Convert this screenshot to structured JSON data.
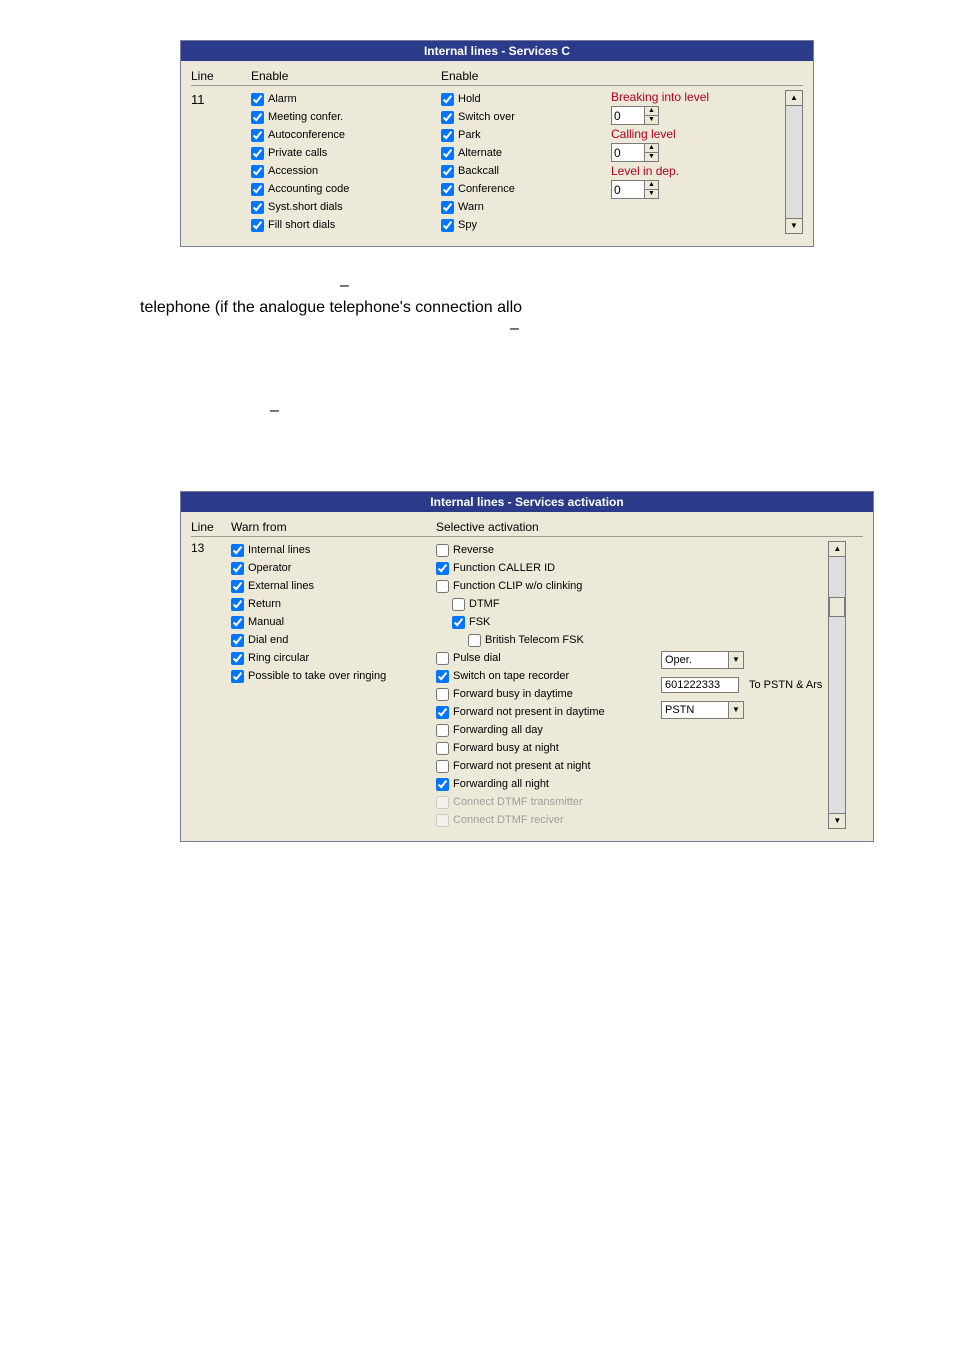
{
  "panel1": {
    "title": "Internal lines - Services C",
    "headers": {
      "line": "Line",
      "enable1": "Enable",
      "enable2": "Enable"
    },
    "line": "11",
    "colA": [
      {
        "label": "Alarm",
        "checked": true
      },
      {
        "label": "Meeting confer.",
        "checked": true
      },
      {
        "label": "Autoconference",
        "checked": true
      },
      {
        "label": "Private calls",
        "checked": true
      },
      {
        "label": "Accession",
        "checked": true
      },
      {
        "label": "Accounting code",
        "checked": true
      },
      {
        "label": "Syst.short dials",
        "checked": true
      },
      {
        "label": "Fill short dials",
        "checked": true
      }
    ],
    "colB": [
      {
        "label": "Hold",
        "checked": true
      },
      {
        "label": "Switch over",
        "checked": true
      },
      {
        "label": "Park",
        "checked": true
      },
      {
        "label": "Alternate",
        "checked": true
      },
      {
        "label": "Backcall",
        "checked": true
      },
      {
        "label": "Conference",
        "checked": true
      },
      {
        "label": "Warn",
        "checked": true
      },
      {
        "label": "Spy",
        "checked": true
      }
    ],
    "spinners": [
      {
        "label": "Breaking into level",
        "value": "0"
      },
      {
        "label": "Calling level",
        "value": "0"
      },
      {
        "label": "Level in dep.",
        "value": "0"
      }
    ]
  },
  "doc_dash1": "–",
  "doc_line2": "telephone (if the analogue telephone's connection allo",
  "doc_dash2": "–",
  "doc_dash3": "–",
  "panel2": {
    "title": "Internal lines - Services activation",
    "headers": {
      "line": "Line",
      "warn": "Warn from",
      "sel": "Selective activation"
    },
    "line": "13",
    "warn": [
      {
        "label": "Internal lines",
        "checked": true
      },
      {
        "label": "Operator",
        "checked": true
      },
      {
        "label": "External lines",
        "checked": true
      },
      {
        "label": "Return",
        "checked": true
      },
      {
        "label": "Manual",
        "checked": true
      },
      {
        "label": "Dial end",
        "checked": true
      },
      {
        "label": "Ring circular",
        "checked": true
      },
      {
        "label": "Possible to take over ringing",
        "checked": true
      }
    ],
    "sel": [
      {
        "label": "Reverse",
        "checked": false,
        "indent": 0
      },
      {
        "label": "Function CALLER ID",
        "checked": true,
        "indent": 0
      },
      {
        "label": "Function CLIP w/o clinking",
        "checked": false,
        "indent": 0
      },
      {
        "label": "DTMF",
        "checked": false,
        "indent": 1
      },
      {
        "label": "FSK",
        "checked": true,
        "indent": 1
      },
      {
        "label": "British Telecom FSK",
        "checked": false,
        "indent": 2
      },
      {
        "label": "Pulse dial",
        "checked": false,
        "indent": 0
      },
      {
        "label": "Switch on tape recorder",
        "checked": true,
        "indent": 0
      },
      {
        "label": "Forward busy in daytime",
        "checked": false,
        "indent": 0
      },
      {
        "label": "Forward not present in daytime",
        "checked": true,
        "indent": 0
      },
      {
        "label": "Forwarding all day",
        "checked": false,
        "indent": 0
      },
      {
        "label": "Forward busy at night",
        "checked": false,
        "indent": 0
      },
      {
        "label": "Forward not present at night",
        "checked": false,
        "indent": 0
      },
      {
        "label": "Forwarding all night",
        "checked": true,
        "indent": 0
      },
      {
        "label": "Connect DTMF transmitter",
        "checked": false,
        "indent": 0,
        "disabled": true
      },
      {
        "label": "Connect DTMF reciver",
        "checked": false,
        "indent": 0,
        "disabled": true
      }
    ],
    "oper_label": "Oper.",
    "oper_value": "",
    "number_value": "601222333",
    "number_right": "To PSTN & Ars",
    "pstn_label": "PSTN",
    "pstn_value": ""
  }
}
